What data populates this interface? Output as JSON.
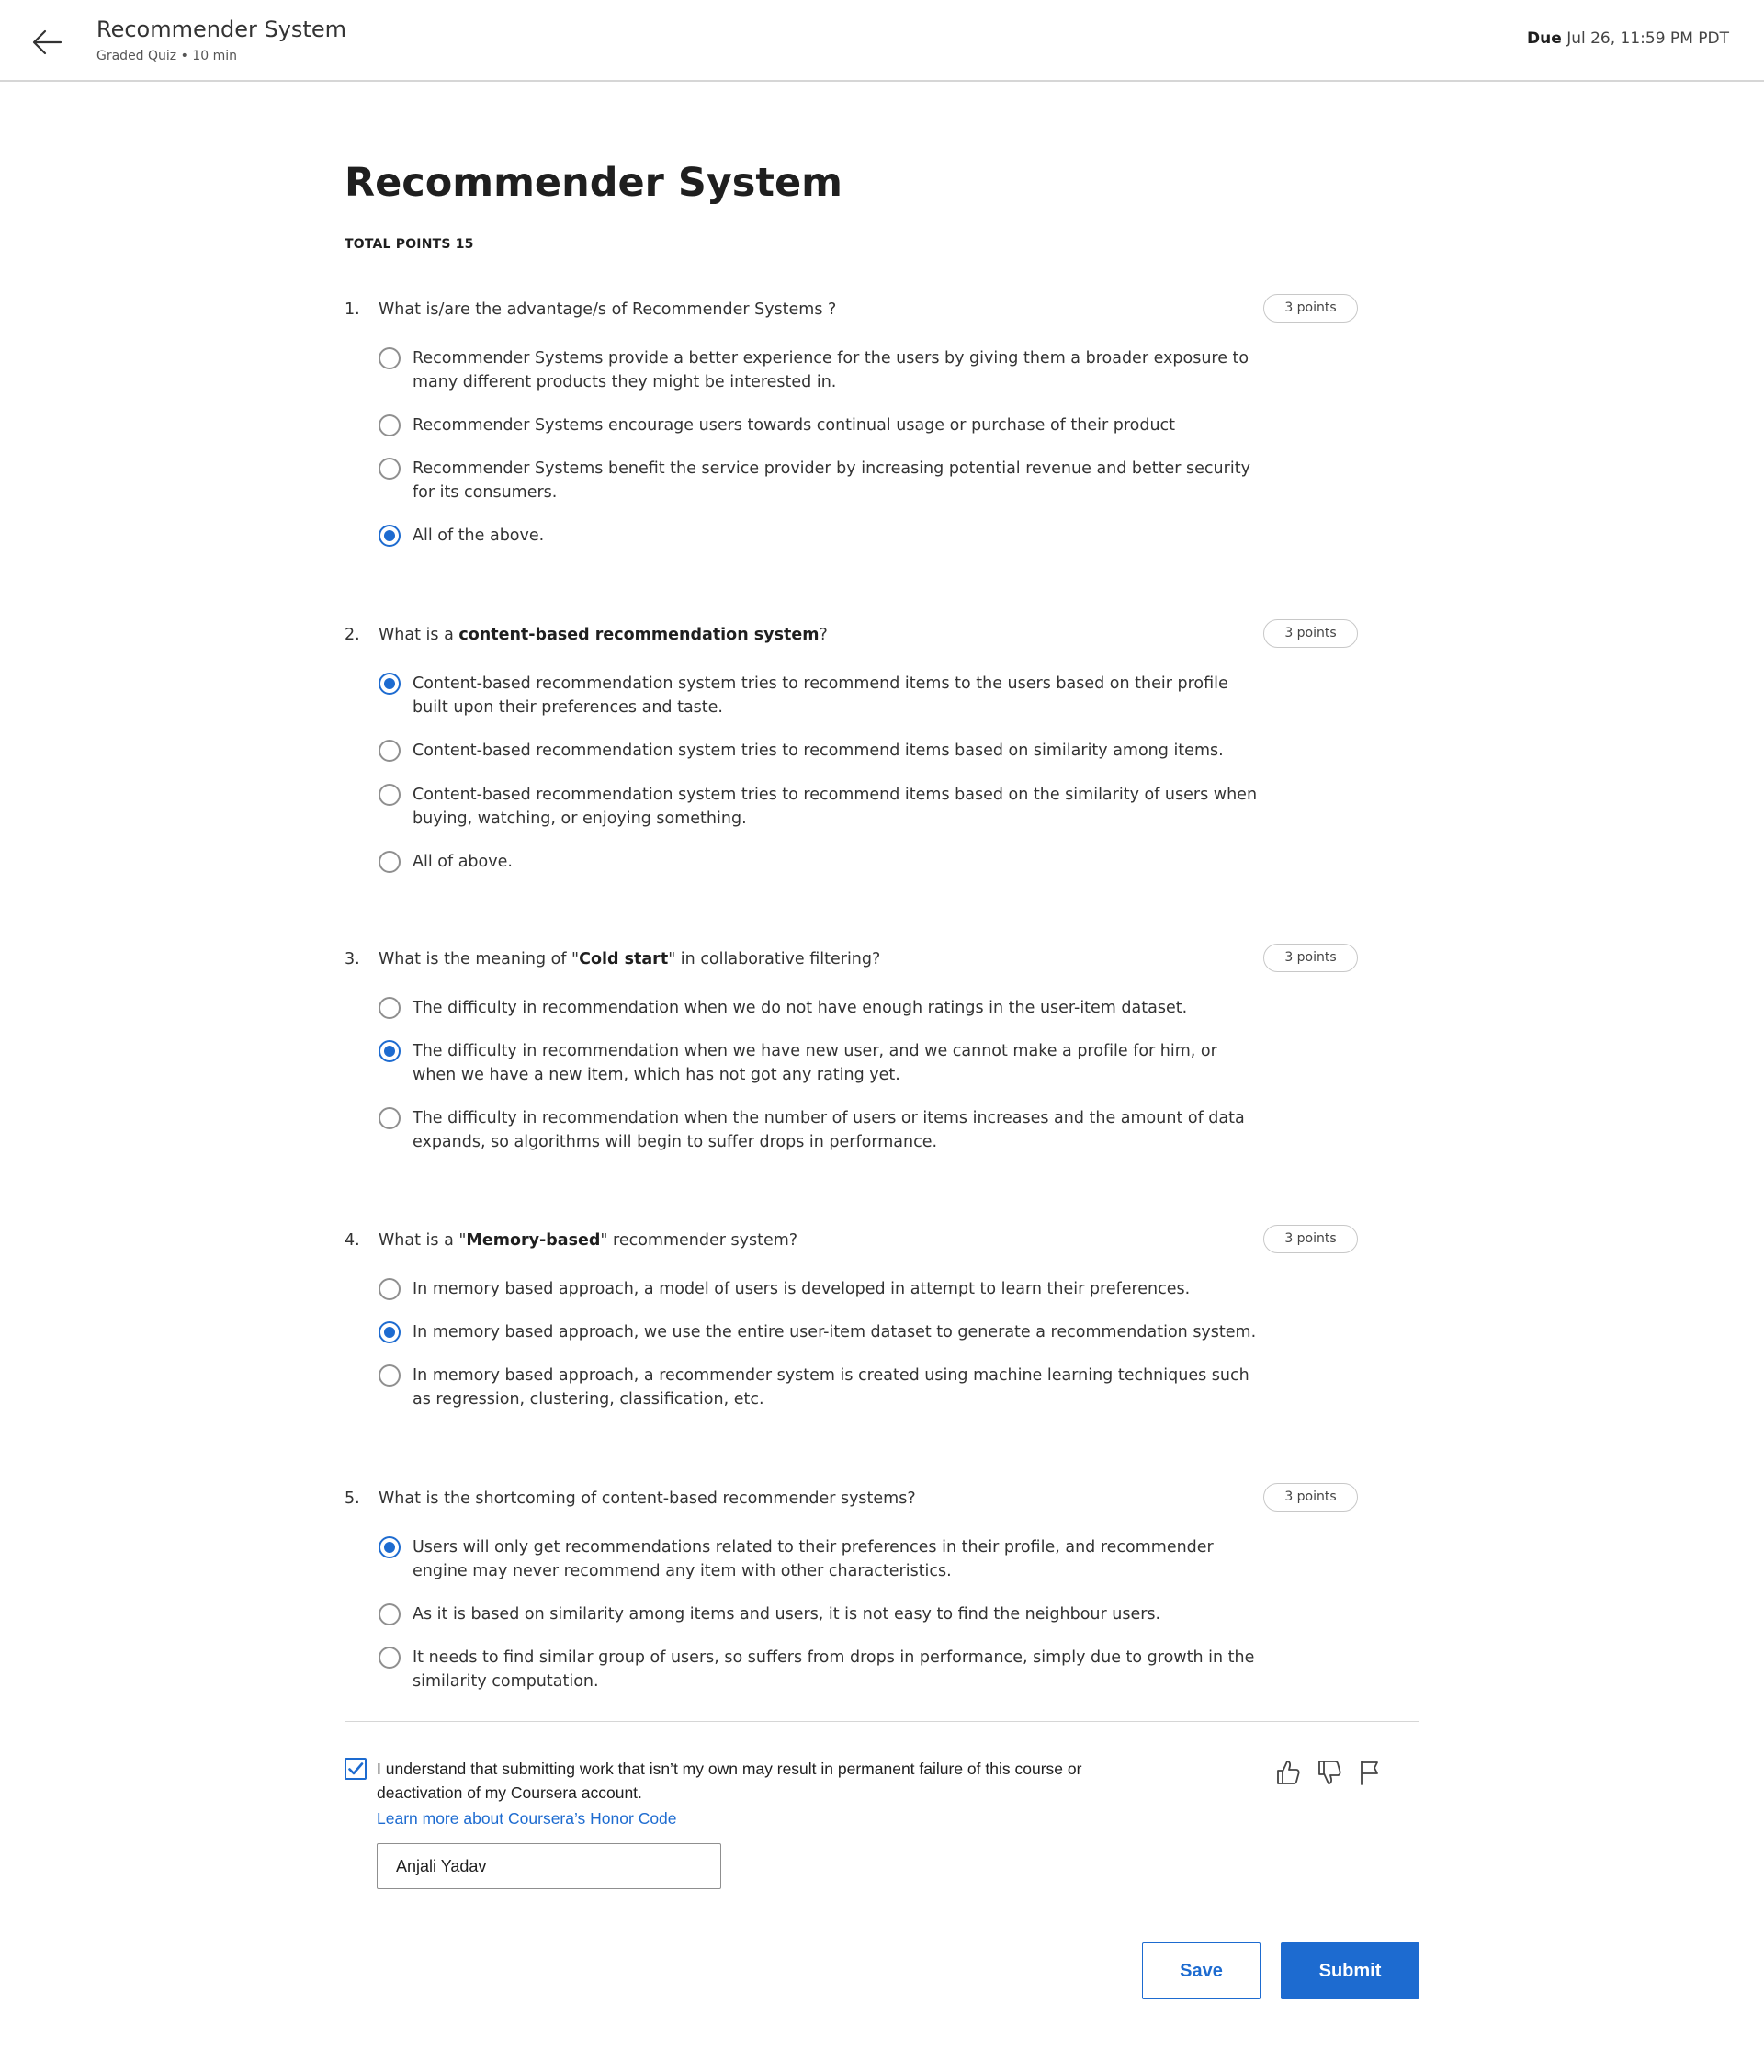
{
  "header": {
    "title": "Recommender System",
    "subtitle": "Graded Quiz • 10 min",
    "due_label": "Due",
    "due_value": "Jul 26, 11:59 PM PDT"
  },
  "quiz": {
    "title": "Recommender System",
    "total_points": "TOTAL POINTS 15"
  },
  "questions": [
    {
      "number": "1.",
      "text_before": "What is/are the advantage/s of Recommender Systems ?",
      "text_bold": "",
      "text_after": "",
      "points": "3 points",
      "options": [
        {
          "text": "Recommender Systems provide a better experience for the users by giving them a broader exposure to many different products they might be interested in.",
          "selected": false
        },
        {
          "text": "Recommender Systems encourage users towards continual usage or purchase of their product",
          "selected": false
        },
        {
          "text": "Recommender Systems benefit the service provider by increasing potential revenue and better security for its consumers.",
          "selected": false
        },
        {
          "text": "All of the above.",
          "selected": true
        }
      ]
    },
    {
      "number": "2.",
      "text_before": "What is a ",
      "text_bold": "content-based recommendation system",
      "text_after": "?",
      "points": "3 points",
      "options": [
        {
          "text": "Content-based recommendation system tries to recommend items to the users based on their profile built upon their preferences and taste.",
          "selected": true
        },
        {
          "text": "Content-based recommendation system tries to recommend items based on similarity among items.",
          "selected": false
        },
        {
          "text": "Content-based recommendation system tries to recommend items based on the similarity of users when buying, watching, or enjoying something.",
          "selected": false
        },
        {
          "text": "All of above.",
          "selected": false
        }
      ]
    },
    {
      "number": "3.",
      "text_before": "What is the meaning of \"",
      "text_bold": "Cold start",
      "text_after": "\" in collaborative filtering?",
      "points": "3 points",
      "options": [
        {
          "text": "The difficulty in recommendation when we do not have enough ratings in the user-item dataset.",
          "selected": false
        },
        {
          "text": "The difficulty in recommendation when we have new user, and we cannot make a profile for him, or when we have a new item, which has not got any rating yet.",
          "selected": true
        },
        {
          "text": "The difficulty in recommendation when the number of users or items increases and the amount of data expands, so algorithms will begin to suffer drops in performance.",
          "selected": false
        }
      ]
    },
    {
      "number": "4.",
      "text_before": "What is a \"",
      "text_bold": "Memory-based",
      "text_after": "\" recommender system?",
      "points": "3 points",
      "options": [
        {
          "text": "In memory based approach, a model of users is developed in attempt to learn their preferences.",
          "selected": false
        },
        {
          "text": "In memory based approach, we use the entire user-item dataset to generate a recommendation system.",
          "selected": true
        },
        {
          "text": "In memory based approach, a recommender system is created using machine learning techniques such as regression, clustering, classification, etc.",
          "selected": false
        }
      ]
    },
    {
      "number": "5.",
      "text_before": "What is the shortcoming of content-based recommender systems?",
      "text_bold": "",
      "text_after": "",
      "points": "3 points",
      "options": [
        {
          "text": "Users will only get recommendations related to their preferences in their profile, and recommender engine may never recommend any item with other characteristics.",
          "selected": true
        },
        {
          "text": "As it is based on similarity among items and users, it is not easy to find the neighbour users.",
          "selected": false
        },
        {
          "text": "It needs to find similar group of users, so suffers from drops in performance, simply due to growth in the similarity computation.",
          "selected": false
        }
      ]
    }
  ],
  "honor": {
    "checked": true,
    "text": "I understand that submitting work that isn’t my own may result in permanent failure of this course or deactivation of my Coursera account.",
    "link": "Learn more about Coursera’s Honor Code",
    "name_value": "Anjali Yadav"
  },
  "icons": {
    "back": "arrow-left-icon",
    "like": "thumbs-up-icon",
    "dislike": "thumbs-down-icon",
    "flag": "flag-icon",
    "check": "checkmark-icon"
  },
  "actions": {
    "save_label": "Save",
    "submit_label": "Submit"
  },
  "colors": {
    "accent": "#1d6bd0",
    "text": "#1f1f1f",
    "border": "#d6d6d6"
  }
}
